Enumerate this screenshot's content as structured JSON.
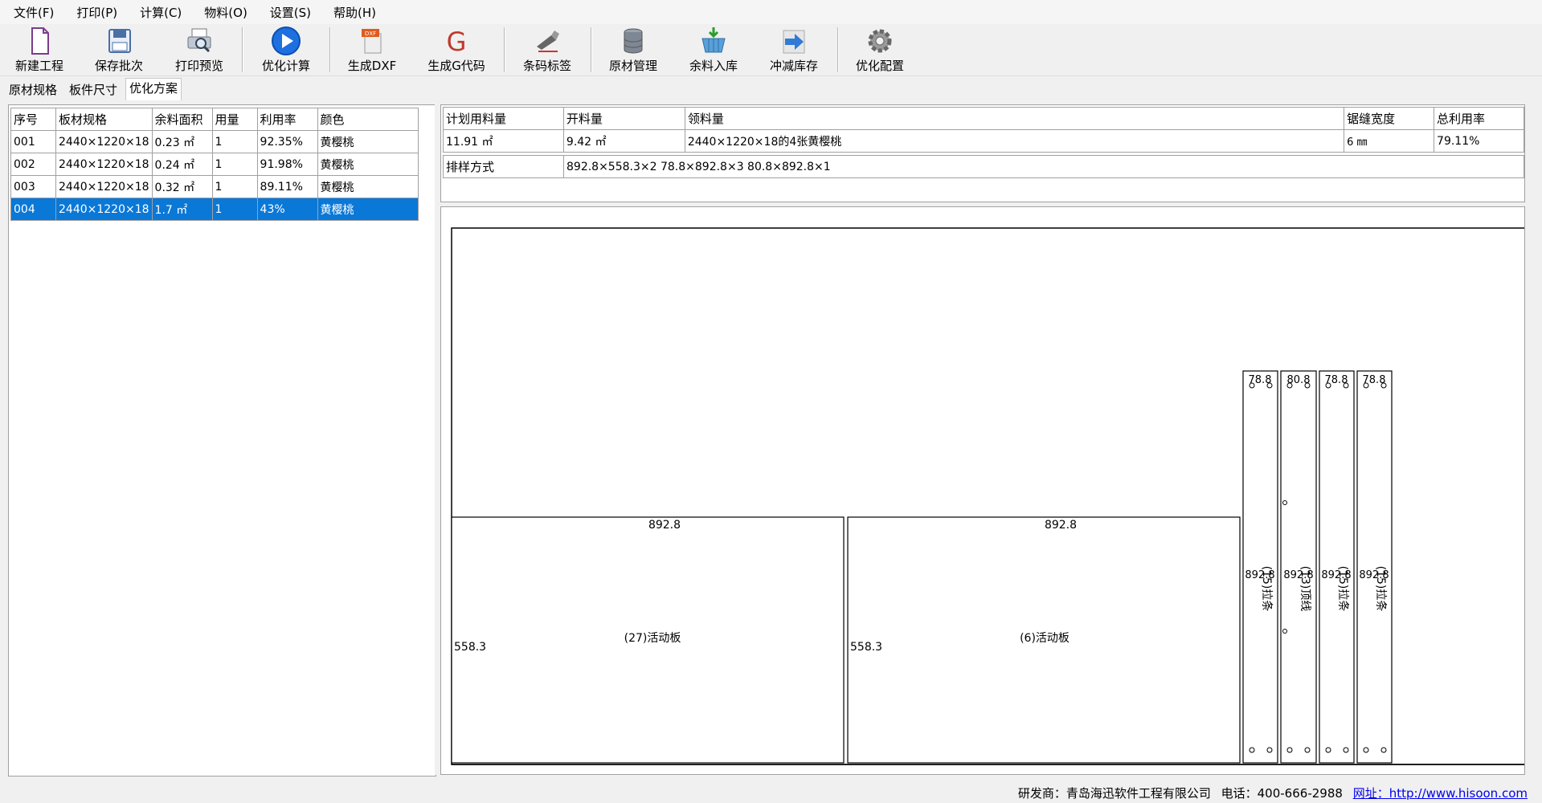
{
  "menu": [
    "文件(F)",
    "打印(P)",
    "计算(C)",
    "物料(O)",
    "设置(S)",
    "帮助(H)"
  ],
  "toolbar": [
    {
      "label": "新建工程",
      "icon": "new-project-icon"
    },
    {
      "label": "保存批次",
      "icon": "save-icon"
    },
    {
      "label": "打印预览",
      "icon": "print-preview-icon"
    },
    {
      "label": "优化计算",
      "icon": "play-icon"
    },
    {
      "label": "生成DXF",
      "icon": "dxf-icon"
    },
    {
      "label": "生成G代码",
      "icon": "gcode-icon"
    },
    {
      "label": "条码标签",
      "icon": "barcode-scanner-icon"
    },
    {
      "label": "原材管理",
      "icon": "database-icon"
    },
    {
      "label": "余料入库",
      "icon": "basket-icon"
    },
    {
      "label": "冲减库存",
      "icon": "arrow-right-icon"
    },
    {
      "label": "优化配置",
      "icon": "gear-icon"
    }
  ],
  "tabs": [
    "原材规格",
    "板件尺寸",
    "优化方案"
  ],
  "plan_table": {
    "headers": [
      "序号",
      "板材规格",
      "余料面积",
      "用量",
      "利用率",
      "颜色"
    ],
    "rows": [
      [
        "001",
        "2440×1220×18",
        "0.23 ㎡",
        "1",
        "92.35%",
        "黄樱桃"
      ],
      [
        "002",
        "2440×1220×18",
        "0.24 ㎡",
        "1",
        "91.98%",
        "黄樱桃"
      ],
      [
        "003",
        "2440×1220×18",
        "0.32 ㎡",
        "1",
        "89.11%",
        "黄樱桃"
      ],
      [
        "004",
        "2440×1220×18",
        "1.7 ㎡",
        "1",
        "43%",
        "黄樱桃"
      ]
    ],
    "selected_index": 3
  },
  "summary": {
    "headers": [
      "计划用料量",
      "开料量",
      "领料量",
      "锯缝宽度",
      "总利用率"
    ],
    "values": [
      "11.91 ㎡",
      "9.42 ㎡",
      "2440×1220×18的4张黄樱桃",
      "6 ㎜",
      "79.11%"
    ],
    "layout_label": "排样方式",
    "layout_value": "892.8×558.3×2 78.8×892.8×3 80.8×892.8×1"
  },
  "drawing": {
    "big_parts": [
      {
        "width_label": "892.8",
        "height_label": "558.3",
        "name": "(27)活动板"
      },
      {
        "width_label": "892.8",
        "height_label": "558.3",
        "name": "(6)活动板"
      }
    ],
    "strips": [
      {
        "width_label": "78.8",
        "height_label": "892.8",
        "name": "(15)拉条"
      },
      {
        "width_label": "80.8",
        "height_label": "892.8",
        "name": "(13)顶线"
      },
      {
        "width_label": "78.8",
        "height_label": "892.8",
        "name": "(15)拉条"
      },
      {
        "width_label": "78.8",
        "height_label": "892.8",
        "name": "(15)拉条"
      }
    ]
  },
  "status": {
    "developer": "研发商：青岛海迅软件工程有限公司",
    "phone": "电话：400-666-2988",
    "website": "网址：http://www.hisoon.com"
  }
}
